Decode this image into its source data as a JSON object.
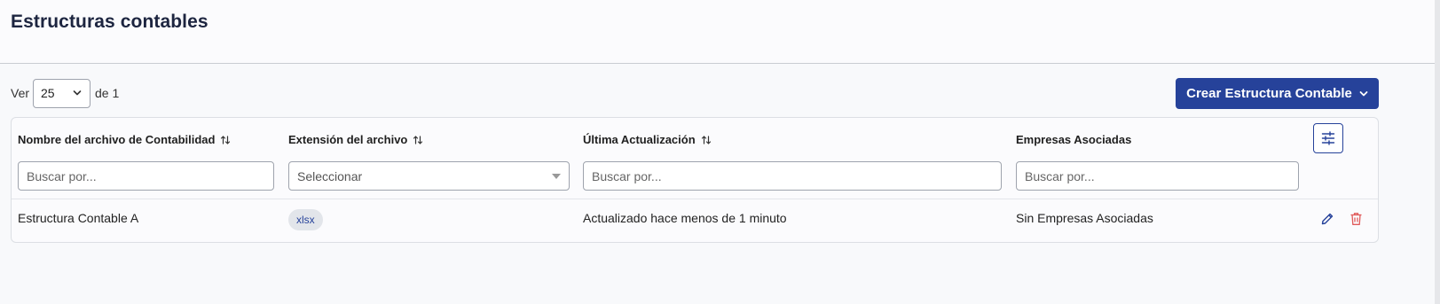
{
  "page": {
    "title": "Estructuras contables"
  },
  "pager": {
    "prefix": "Ver",
    "page_size": "25",
    "suffix": "de 1"
  },
  "actions": {
    "create_label": "Crear Estructura Contable"
  },
  "table": {
    "columns": [
      {
        "label": "Nombre del archivo de Contabilidad",
        "sortable": true
      },
      {
        "label": "Extensión del archivo",
        "sortable": true
      },
      {
        "label": "Última Actualización",
        "sortable": true
      },
      {
        "label": "Empresas Asociadas",
        "sortable": false
      }
    ],
    "filters": {
      "name_placeholder": "Buscar por...",
      "extension_placeholder": "Seleccionar",
      "updated_placeholder": "Buscar por...",
      "companies_placeholder": "Buscar por..."
    },
    "rows": [
      {
        "name": "Estructura Contable A",
        "extension": "xlsx",
        "updated": "Actualizado hace menos de 1 minuto",
        "companies": "Sin Empresas Asociadas"
      }
    ]
  },
  "colors": {
    "primary": "#26429a",
    "danger": "#e05a5a",
    "title": "#1d2540"
  },
  "icons": [
    "chevron-down-icon",
    "sort-icon",
    "column-settings-icon",
    "edit-icon",
    "delete-icon"
  ]
}
